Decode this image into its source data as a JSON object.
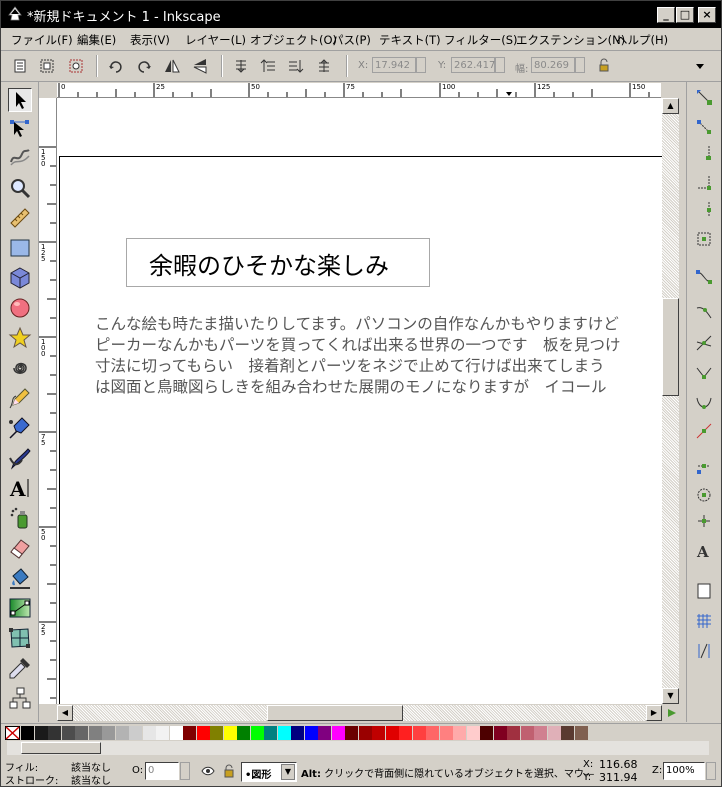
{
  "window": {
    "title": "*新規ドキュメント 1 - Inkscape",
    "minimize": "_",
    "maximize": "□",
    "close": "×"
  },
  "menu": [
    "ファイル(F)",
    "編集(E)",
    "表示(V)",
    "レイヤー(L)",
    "オブジェクト(O)",
    "パス(P)",
    "テキスト(T)",
    "フィルター(S)",
    "エクステンション(N)",
    "ヘルプ(H)"
  ],
  "toolcontrols": {
    "x_label": "X:",
    "x_value": "17.942",
    "y_label": "Y:",
    "y_value": "262.417",
    "w_label": "幅:",
    "w_value": "80.269"
  },
  "ruler": {
    "h_labels": [
      "0",
      "25",
      "50",
      "75",
      "100",
      "125",
      "150"
    ],
    "v_labels": [
      "1 5 0",
      "1 2 5",
      "1 0 0",
      "7 5",
      "5 0",
      "2 5",
      "0",
      "2 5",
      "5 0",
      "7 5",
      "1 0 0",
      "1 2 5",
      "1 5 0"
    ]
  },
  "canvas": {
    "title": "余暇のひそかな楽しみ",
    "lines": [
      "こんな絵も時たま描いたりしてます。パソコンの自作なんかもやりますけど",
      "ピーカーなんかもパーツを買ってくれば出来る世界の一つです　板を見つけ",
      "寸法に切ってもらい　接着剤とパーツをネジで止めて行けば出来てしまう",
      "は図面と鳥瞰図らしきを組み合わせた展開のモノになりますが　イコール"
    ]
  },
  "status": {
    "fill_label": "フィル:",
    "fill_value": "該当なし",
    "stroke_label": "ストローク:",
    "stroke_value": "該当なし",
    "opacity_label": "O:",
    "opacity_value": "0",
    "layer": "•図形",
    "message_bold": "Alt:",
    "message": " クリックで背面側に隠れているオブジェクトを選択、マウ―",
    "x_label": "X:",
    "x_value": "116.68",
    "y_label": "Y:",
    "y_value": "311.94",
    "zoom_label": "Z:",
    "zoom_value": "100%"
  },
  "palette": [
    "#000000",
    "#1a1a1a",
    "#333333",
    "#4d4d4d",
    "#666666",
    "#808080",
    "#999999",
    "#b3b3b3",
    "#cccccc",
    "#e6e6e6",
    "#f2f2f2",
    "#ffffff",
    "#800000",
    "#ff0000",
    "#808000",
    "#ffff00",
    "#008000",
    "#00ff00",
    "#008080",
    "#00ffff",
    "#000080",
    "#0000ff",
    "#800080",
    "#ff00ff",
    "#6a0000",
    "#9a0000",
    "#c00000",
    "#e00000",
    "#ff2020",
    "#ff4040",
    "#ff6666",
    "#ff8080",
    "#ffaaaa",
    "#ffcccc",
    "#4d0000",
    "#800020",
    "#a03040",
    "#c06070",
    "#d08090",
    "#e0b0b8",
    "#5a3a30",
    "#806050"
  ]
}
